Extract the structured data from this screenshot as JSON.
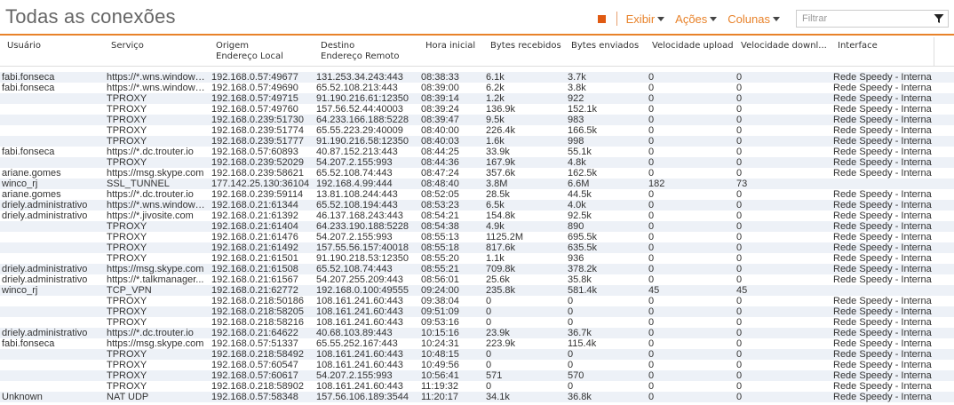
{
  "title": "Todas as conexões",
  "toolbar": {
    "menus": [
      "Exibir",
      "Ações",
      "Colunas"
    ],
    "filter_placeholder": "Filtrar",
    "accent": "#e8822a"
  },
  "columns": [
    [
      "Usuário",
      ""
    ],
    [
      "Serviço",
      ""
    ],
    [
      "Origem",
      "Endereço Local"
    ],
    [
      "Destino",
      "Endereço Remoto"
    ],
    [
      "Hora inicial",
      ""
    ],
    [
      "Bytes recebidos",
      ""
    ],
    [
      "Bytes enviados",
      ""
    ],
    [
      "Velocidade upload",
      ""
    ],
    [
      "Velocidade downl...",
      ""
    ],
    [
      "Interface",
      ""
    ]
  ],
  "rows": [
    [
      "fabi.fonseca",
      "https://*.wns.windows...",
      "192.168.0.57:49677",
      "131.253.34.243:443",
      "08:38:33",
      "6.1k",
      "3.7k",
      "0",
      "0",
      "Rede Speedy - Interna"
    ],
    [
      "fabi.fonseca",
      "https://*.wns.windows...",
      "192.168.0.57:49690",
      "65.52.108.213:443",
      "08:39:00",
      "6.2k",
      "3.8k",
      "0",
      "0",
      "Rede Speedy - Interna"
    ],
    [
      "",
      "TPROXY",
      "192.168.0.57:49715",
      "91.190.216.61:12350",
      "08:39:14",
      "1.2k",
      "922",
      "0",
      "0",
      "Rede Speedy - Interna"
    ],
    [
      "",
      "TPROXY",
      "192.168.0.57:49760",
      "157.56.52.44:40003",
      "08:39:24",
      "136.9k",
      "152.1k",
      "0",
      "0",
      "Rede Speedy - Interna"
    ],
    [
      "",
      "TPROXY",
      "192.168.0.239:51730",
      "64.233.166.188:5228",
      "08:39:47",
      "9.5k",
      "983",
      "0",
      "0",
      "Rede Speedy - Interna"
    ],
    [
      "",
      "TPROXY",
      "192.168.0.239:51774",
      "65.55.223.29:40009",
      "08:40:00",
      "226.4k",
      "166.5k",
      "0",
      "0",
      "Rede Speedy - Interna"
    ],
    [
      "",
      "TPROXY",
      "192.168.0.239:51777",
      "91.190.216.58:12350",
      "08:40:03",
      "1.6k",
      "998",
      "0",
      "0",
      "Rede Speedy - Interna"
    ],
    [
      "fabi.fonseca",
      "https://*.dc.trouter.io",
      "192.168.0.57:60893",
      "40.87.152.213:443",
      "08:44:25",
      "33.9k",
      "55.1k",
      "0",
      "0",
      "Rede Speedy - Interna"
    ],
    [
      "",
      "TPROXY",
      "192.168.0.239:52029",
      "54.207.2.155:993",
      "08:44:36",
      "167.9k",
      "4.8k",
      "0",
      "0",
      "Rede Speedy - Interna"
    ],
    [
      "ariane.gomes",
      "https://msg.skype.com",
      "192.168.0.239:58621",
      "65.52.108.74:443",
      "08:47:24",
      "357.6k",
      "162.5k",
      "0",
      "0",
      "Rede Speedy - Interna"
    ],
    [
      "winco_rj",
      "SSL_TUNNEL",
      "177.142.25.130:36104",
      "192.168.4.99:444",
      "08:48:40",
      "3.8M",
      "6.6M",
      "182",
      "73",
      ""
    ],
    [
      "ariane.gomes",
      "https://*.dc.trouter.io",
      "192.168.0.239:59114",
      "13.81.108.244:443",
      "08:52:05",
      "28.5k",
      "44.5k",
      "0",
      "0",
      "Rede Speedy - Interna"
    ],
    [
      "driely.administrativo",
      "https://*.wns.windows...",
      "192.168.0.21:61344",
      "65.52.108.194:443",
      "08:53:23",
      "6.5k",
      "4.0k",
      "0",
      "0",
      "Rede Speedy - Interna"
    ],
    [
      "driely.administrativo",
      "https://*.jivosite.com",
      "192.168.0.21:61392",
      "46.137.168.243:443",
      "08:54:21",
      "154.8k",
      "92.5k",
      "0",
      "0",
      "Rede Speedy - Interna"
    ],
    [
      "",
      "TPROXY",
      "192.168.0.21:61404",
      "64.233.190.188:5228",
      "08:54:38",
      "4.9k",
      "890",
      "0",
      "0",
      "Rede Speedy - Interna"
    ],
    [
      "",
      "TPROXY",
      "192.168.0.21:61476",
      "54.207.2.155:993",
      "08:55:13",
      "1125.2M",
      "695.5k",
      "0",
      "0",
      "Rede Speedy - Interna"
    ],
    [
      "",
      "TPROXY",
      "192.168.0.21:61492",
      "157.55.56.157:40018",
      "08:55:18",
      "817.6k",
      "635.5k",
      "0",
      "0",
      "Rede Speedy - Interna"
    ],
    [
      "",
      "TPROXY",
      "192.168.0.21:61501",
      "91.190.218.53:12350",
      "08:55:20",
      "1.1k",
      "936",
      "0",
      "0",
      "Rede Speedy - Interna"
    ],
    [
      "driely.administrativo",
      "https://msg.skype.com",
      "192.168.0.21:61508",
      "65.52.108.74:443",
      "08:55:21",
      "709.8k",
      "378.2k",
      "0",
      "0",
      "Rede Speedy - Interna"
    ],
    [
      "driely.administrativo",
      "https://*.talkmanager...",
      "192.168.0.21:61567",
      "54.207.255.209:443",
      "08:56:01",
      "25.6k",
      "35.8k",
      "0",
      "0",
      "Rede Speedy - Interna"
    ],
    [
      "winco_rj",
      "TCP_VPN",
      "192.168.0.21:62772",
      "192.168.0.100:49555",
      "09:24:00",
      "235.8k",
      "581.4k",
      "45",
      "45",
      ""
    ],
    [
      "",
      "TPROXY",
      "192.168.0.218:50186",
      "108.161.241.60:443",
      "09:38:04",
      "0",
      "0",
      "0",
      "0",
      "Rede Speedy - Interna"
    ],
    [
      "",
      "TPROXY",
      "192.168.0.218:58205",
      "108.161.241.60:443",
      "09:51:09",
      "0",
      "0",
      "0",
      "0",
      "Rede Speedy - Interna"
    ],
    [
      "",
      "TPROXY",
      "192.168.0.218:58216",
      "108.161.241.60:443",
      "09:53:16",
      "0",
      "0",
      "0",
      "0",
      "Rede Speedy - Interna"
    ],
    [
      "driely.administrativo",
      "https://*.dc.trouter.io",
      "192.168.0.21:64622",
      "40.68.103.89:443",
      "10:15:16",
      "23.9k",
      "36.7k",
      "0",
      "0",
      "Rede Speedy - Interna"
    ],
    [
      "fabi.fonseca",
      "https://msg.skype.com",
      "192.168.0.57:51337",
      "65.55.252.167:443",
      "10:24:31",
      "223.9k",
      "115.4k",
      "0",
      "0",
      "Rede Speedy - Interna"
    ],
    [
      "",
      "TPROXY",
      "192.168.0.218:58492",
      "108.161.241.60:443",
      "10:48:15",
      "0",
      "0",
      "0",
      "0",
      "Rede Speedy - Interna"
    ],
    [
      "",
      "TPROXY",
      "192.168.0.57:60547",
      "108.161.241.60:443",
      "10:49:56",
      "0",
      "0",
      "0",
      "0",
      "Rede Speedy - Interna"
    ],
    [
      "",
      "TPROXY",
      "192.168.0.57:60617",
      "54.207.2.155:993",
      "10:56:41",
      "571",
      "570",
      "0",
      "0",
      "Rede Speedy - Interna"
    ],
    [
      "",
      "TPROXY",
      "192.168.0.218:58902",
      "108.161.241.60:443",
      "11:19:32",
      "0",
      "0",
      "0",
      "0",
      "Rede Speedy - Interna"
    ],
    [
      "Unknown",
      "NAT UDP",
      "192.168.0.57:58348",
      "157.56.106.189:3544",
      "11:20:17",
      "34.1k",
      "36.8k",
      "0",
      "0",
      "Rede Speedy - Interna"
    ]
  ]
}
